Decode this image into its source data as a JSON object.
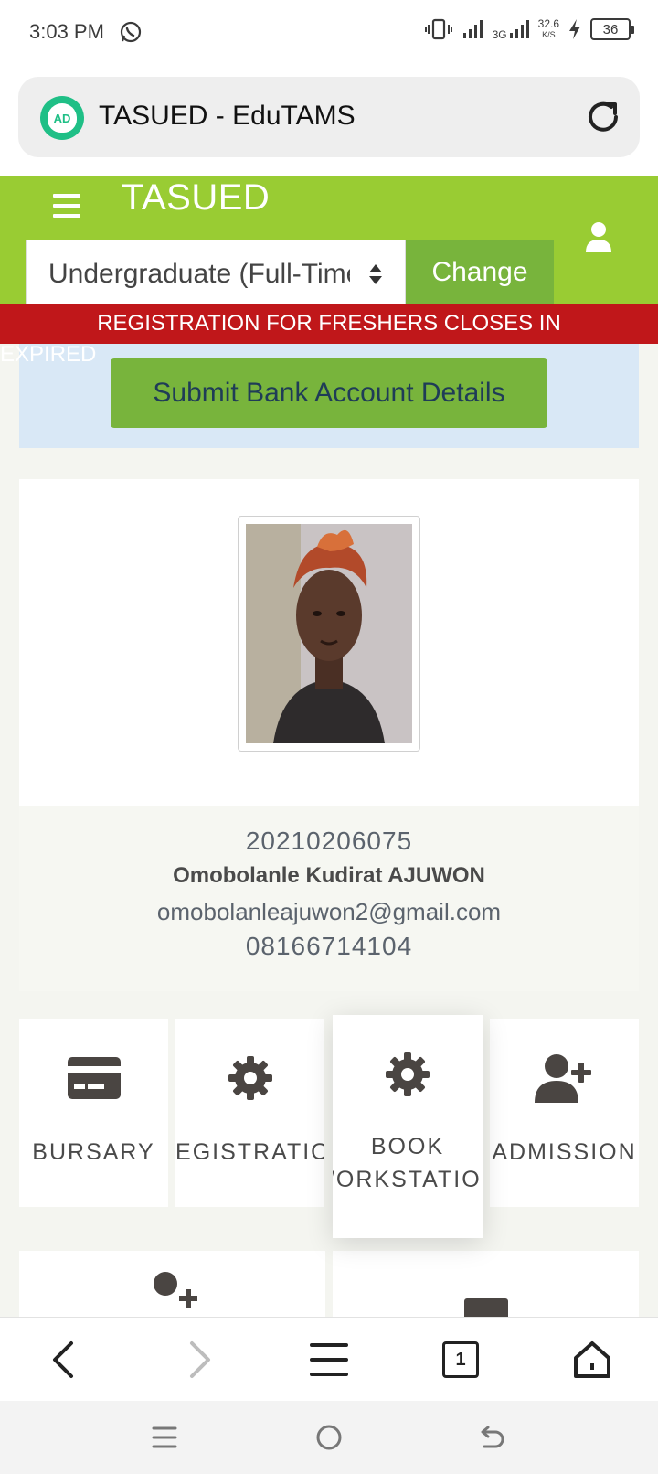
{
  "status_bar": {
    "time": "3:03 PM",
    "net_speed": "32.6",
    "net_unit": "K/S",
    "network": "3G",
    "battery": "36"
  },
  "browser": {
    "site_badge": "AD",
    "title": "TASUED - EduTAMS",
    "tab_count": "1"
  },
  "header": {
    "brand": "TASUED",
    "program_select": "Undergraduate (Full-Time)",
    "change_label": "Change",
    "accent_color": "#99cc33"
  },
  "banner": {
    "text": "REGISTRATION FOR FRESHERS CLOSES IN",
    "status": "EXPIRED",
    "color": "#c0171a"
  },
  "bank": {
    "button_label": "Submit Bank Account Details"
  },
  "profile": {
    "matric": "20210206075",
    "name": "Omobolanle Kudirat AJUWON",
    "email": "omobolanleajuwon2@gmail.com",
    "phone": "08166714104"
  },
  "tiles": [
    {
      "label": "BURSARY",
      "icon": "credit-card-icon"
    },
    {
      "label": "REGISTRATION",
      "icon": "gear-icon"
    },
    {
      "label_line1": "BOOK",
      "label_line2": "WORKSTATION",
      "icon": "gear-icon"
    },
    {
      "label": "ADMISSION",
      "icon": "user-plus-icon"
    }
  ]
}
